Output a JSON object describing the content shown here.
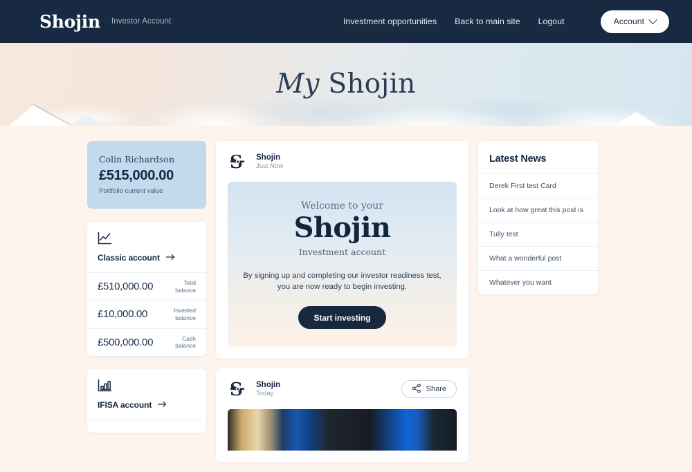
{
  "header": {
    "brand": "Shojin",
    "subtitle": "Investor Account",
    "nav": [
      {
        "label": "Investment opportunities"
      },
      {
        "label": "Back to main site"
      },
      {
        "label": "Logout"
      }
    ],
    "account_button": "Account"
  },
  "hero": {
    "title_italic": "My",
    "title_rest": "Shojin"
  },
  "portfolio": {
    "name": "Colin Richardson",
    "amount": "£515,000.00",
    "label": "Portfolio current value",
    "bg_color": "#c3d9ed"
  },
  "accounts": [
    {
      "icon": "line-chart-icon",
      "title": "Classic account",
      "rows": [
        {
          "value": "£510,000.00",
          "key": "Total balance"
        },
        {
          "value": "£10,000.00",
          "key": "Invested balance"
        },
        {
          "value": "£500,000.00",
          "key": "Cash balance"
        }
      ]
    },
    {
      "icon": "bar-chart-icon",
      "title": "IFISA account",
      "rows": []
    }
  ],
  "feed": [
    {
      "author": "Shojin",
      "time": "Just Now",
      "has_share": false,
      "welcome": {
        "superline": "Welcome to your",
        "headline": "Shojin",
        "subline": "Investment account",
        "body": "By signing up and completing our investor readiness test, you are now ready to begin investing.",
        "cta": "Start investing"
      }
    },
    {
      "author": "Shojin",
      "time": "Today",
      "has_share": true,
      "share_label": "Share"
    }
  ],
  "news": {
    "title": "Latest News",
    "items": [
      {
        "label": "Derek First test Card"
      },
      {
        "label": "Look at how great this post is"
      },
      {
        "label": "Tully test"
      },
      {
        "label": "What a wonderful post"
      },
      {
        "label": "Whatever you want"
      }
    ]
  },
  "theme": {
    "page_bg": "#fdf4ed",
    "navy": "#17283f",
    "accent_blue": "#c3d9ed"
  }
}
